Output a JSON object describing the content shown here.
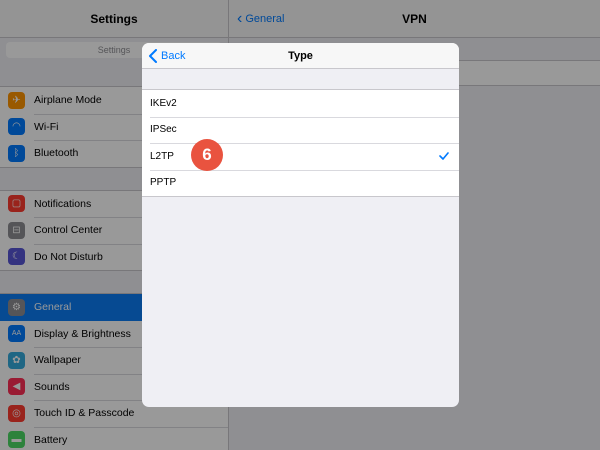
{
  "master": {
    "title": "Settings",
    "search_placeholder": "Settings",
    "groups": [
      [
        {
          "label": "Airplane Mode",
          "icon": "airplane-icon",
          "color": "#ff9500",
          "glyph": "✈"
        },
        {
          "label": "Wi-Fi",
          "icon": "wifi-icon",
          "color": "#007aff",
          "glyph": "◠"
        },
        {
          "label": "Bluetooth",
          "icon": "bluetooth-icon",
          "color": "#007aff",
          "glyph": "ᛒ"
        }
      ],
      [
        {
          "label": "Notifications",
          "icon": "notifications-icon",
          "color": "#ff3b30",
          "glyph": "▢"
        },
        {
          "label": "Control Center",
          "icon": "control-center-icon",
          "color": "#8e8e93",
          "glyph": "⊟"
        },
        {
          "label": "Do Not Disturb",
          "icon": "moon-icon",
          "color": "#5856d6",
          "glyph": "☾"
        }
      ],
      [
        {
          "label": "General",
          "icon": "gear-icon",
          "color": "#8e8e93",
          "glyph": "⚙",
          "selected": true
        },
        {
          "label": "Display & Brightness",
          "icon": "display-icon",
          "color": "#007aff",
          "glyph": "AA"
        },
        {
          "label": "Wallpaper",
          "icon": "wallpaper-icon",
          "color": "#34aadc",
          "glyph": "✿"
        },
        {
          "label": "Sounds",
          "icon": "sounds-icon",
          "color": "#ff2d55",
          "glyph": "◀"
        },
        {
          "label": "Touch ID & Passcode",
          "icon": "fingerprint-icon",
          "color": "#ff3b30",
          "glyph": "◎"
        },
        {
          "label": "Battery",
          "icon": "battery-icon",
          "color": "#4cd964",
          "glyph": "▬"
        }
      ]
    ]
  },
  "detail": {
    "back_label": "General",
    "title": "VPN"
  },
  "modal": {
    "back_label": "Back",
    "title": "Type",
    "options": [
      "IKEv2",
      "IPSec",
      "L2TP",
      "PPTP"
    ],
    "selected": "L2TP"
  },
  "badge": {
    "text": "6",
    "color": "#e9533f"
  },
  "accent": "#007aff"
}
